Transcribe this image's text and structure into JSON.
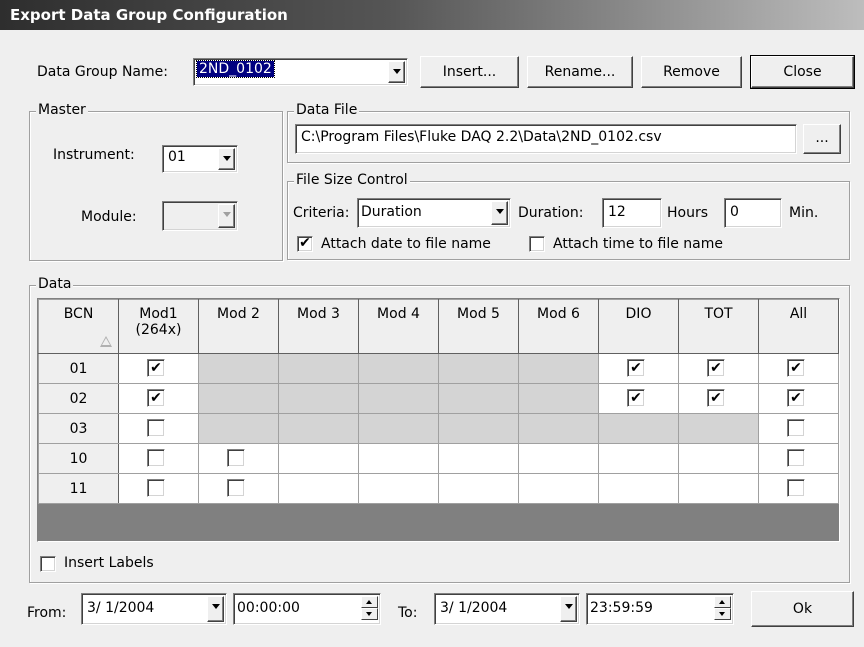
{
  "window": {
    "title": "Export Data Group Configuration"
  },
  "top": {
    "data_group_label": "Data Group Name:",
    "data_group_value": "2ND_0102",
    "insert_label": "Insert...",
    "rename_label": "Rename...",
    "remove_label": "Remove",
    "close_label": "Close"
  },
  "master": {
    "title": "Master",
    "instrument_label": "Instrument:",
    "instrument_value": "01",
    "module_label": "Module:",
    "module_value": ""
  },
  "data_file": {
    "title": "Data File",
    "path": "C:\\Program Files\\Fluke DAQ 2.2\\Data\\2ND_0102.csv",
    "browse_label": "..."
  },
  "file_size": {
    "title": "File Size Control",
    "criteria_label": "Criteria:",
    "criteria_value": "Duration",
    "duration_label": "Duration:",
    "hours_value": "12",
    "hours_label": "Hours",
    "min_value": "0",
    "min_label": "Min.",
    "attach_date_label": "Attach date to file name",
    "attach_date_checked": true,
    "attach_time_label": "Attach time to file name",
    "attach_time_checked": false
  },
  "data": {
    "title": "Data",
    "columns": [
      "BCN",
      "Mod1\n(264x)",
      "Mod 2",
      "Mod 3",
      "Mod 4",
      "Mod 5",
      "Mod 6",
      "DIO",
      "TOT",
      "All"
    ],
    "rows": [
      {
        "bcn": "01",
        "cells": [
          "checked",
          "off",
          "off",
          "off",
          "off",
          "off",
          "checked",
          "checked",
          "checked"
        ]
      },
      {
        "bcn": "02",
        "cells": [
          "checked",
          "off",
          "off",
          "off",
          "off",
          "off",
          "checked",
          "checked",
          "checked"
        ]
      },
      {
        "bcn": "03",
        "cells": [
          "unchecked",
          "off",
          "off",
          "off",
          "off",
          "off",
          "off",
          "off",
          "unchecked"
        ]
      },
      {
        "bcn": "10",
        "cells": [
          "unchecked",
          "unchecked",
          "empty",
          "empty",
          "empty",
          "empty",
          "empty",
          "empty",
          "unchecked"
        ]
      },
      {
        "bcn": "11",
        "cells": [
          "unchecked",
          "unchecked",
          "empty",
          "empty",
          "empty",
          "empty",
          "empty",
          "empty",
          "unchecked"
        ]
      }
    ],
    "insert_labels_label": "Insert Labels",
    "insert_labels_checked": false
  },
  "range": {
    "from_label": "From:",
    "from_date": "3/ 1/2004",
    "from_time": "00:00:00",
    "to_label": "To:",
    "to_date": "3/ 1/2004",
    "to_time": "23:59:59",
    "ok_label": "Ok"
  },
  "check_glyph": "✔"
}
